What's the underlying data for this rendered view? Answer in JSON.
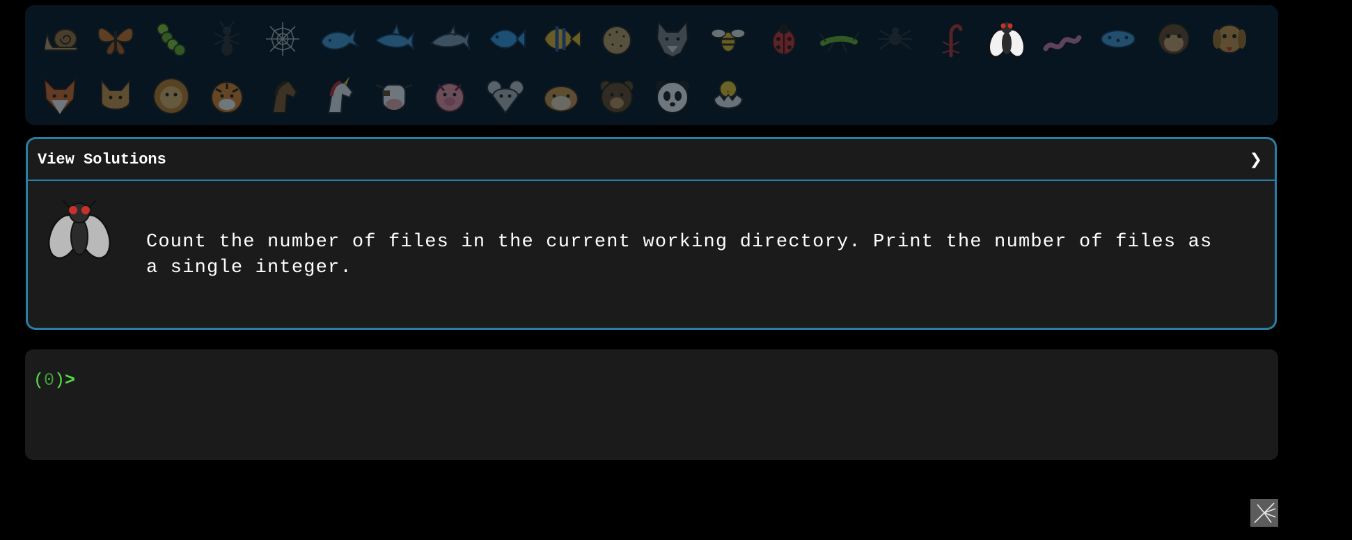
{
  "animals": [
    {
      "name": "snail"
    },
    {
      "name": "butterfly"
    },
    {
      "name": "caterpillar"
    },
    {
      "name": "ant"
    },
    {
      "name": "spider-web"
    },
    {
      "name": "whale"
    },
    {
      "name": "shark"
    },
    {
      "name": "dolphin"
    },
    {
      "name": "fish"
    },
    {
      "name": "tropical-fish"
    },
    {
      "name": "blowfish"
    },
    {
      "name": "wolf"
    },
    {
      "name": "bee"
    },
    {
      "name": "ladybug"
    },
    {
      "name": "cricket"
    },
    {
      "name": "spider"
    },
    {
      "name": "scorpion"
    },
    {
      "name": "fly",
      "active": true
    },
    {
      "name": "worm"
    },
    {
      "name": "microbe"
    },
    {
      "name": "monkey"
    },
    {
      "name": "dog"
    },
    {
      "name": "fox"
    },
    {
      "name": "cat"
    },
    {
      "name": "lion"
    },
    {
      "name": "tiger"
    },
    {
      "name": "horse"
    },
    {
      "name": "unicorn"
    },
    {
      "name": "cow"
    },
    {
      "name": "pig"
    },
    {
      "name": "mouse"
    },
    {
      "name": "hamster"
    },
    {
      "name": "bear"
    },
    {
      "name": "panda"
    },
    {
      "name": "hatching-chick"
    }
  ],
  "solutions": {
    "title": "View Solutions",
    "chevron": "❯",
    "icon": "fly-icon",
    "task": "Count the number of files in the current working directory. Print the number of files as a single integer."
  },
  "terminal": {
    "open_paren": "(",
    "count": "0",
    "close_paren": ")",
    "arrow": ">"
  },
  "colors": {
    "accent": "#2a7ea6",
    "prompt_green": "#55e043",
    "panel_bg": "#1b1b1b",
    "animal_panel_bg": "#061520"
  }
}
